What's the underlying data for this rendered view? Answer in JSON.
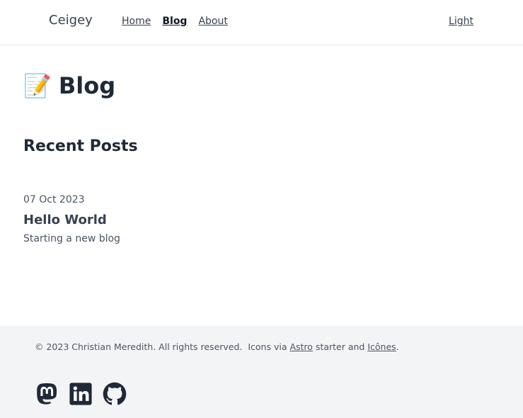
{
  "header": {
    "brand": "Ceigey",
    "nav": [
      {
        "label": "Home"
      },
      {
        "label": "Blog"
      },
      {
        "label": "About"
      }
    ],
    "theme_toggle": "Light"
  },
  "main": {
    "title_icon": "📝",
    "title": "Blog",
    "section_title": "Recent Posts",
    "posts": [
      {
        "date": "07 Oct 2023",
        "title": "Hello World",
        "description": "Starting a new blog"
      }
    ]
  },
  "footer": {
    "copyright_prefix": "© 2023 Christian Meredith. All rights reserved.  Icons via ",
    "astro_link": "Astro",
    "middle_text": " starter and ",
    "icones_link": "Icônes",
    "suffix": ".",
    "socials": [
      {
        "icon": "mastodon-icon"
      },
      {
        "icon": "linkedin-icon"
      },
      {
        "icon": "github-icon"
      }
    ]
  },
  "colors": {
    "text": "#1f2937",
    "footer_bg": "#f3f4f6",
    "divider": "#e5e7eb"
  }
}
